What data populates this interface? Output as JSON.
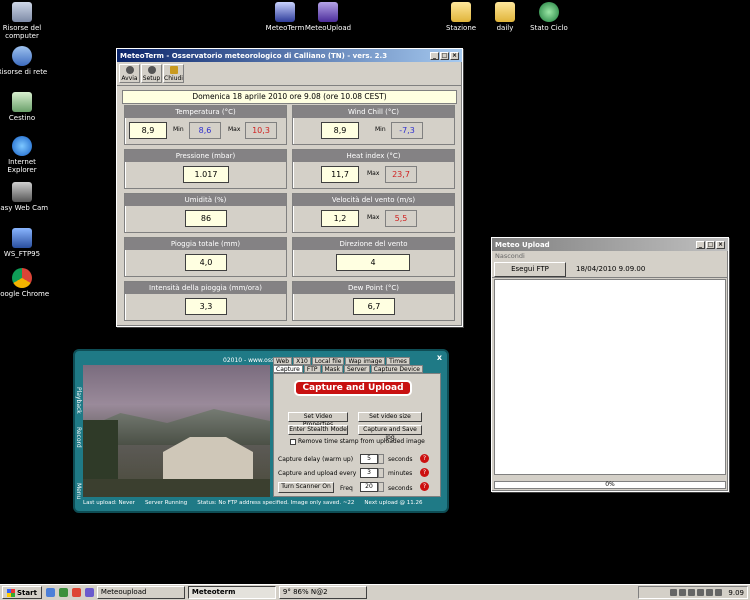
{
  "desktop_icons_left": [
    {
      "label": "Risorse del computer",
      "icon": "my-computer-icon"
    },
    {
      "label": "Risorse di rete",
      "icon": "network-icon"
    },
    {
      "label": "Cestino",
      "icon": "recycle-bin-icon"
    },
    {
      "label": "Internet Explorer",
      "icon": "ie-icon"
    },
    {
      "label": "Easy Web Cam",
      "icon": "webcam-icon"
    },
    {
      "label": "WS_FTP95",
      "icon": "ftp-icon"
    },
    {
      "label": "Google Chrome",
      "icon": "chrome-icon"
    }
  ],
  "desktop_icons_top": [
    {
      "label": "MeteoTerm",
      "icon": "meteoterm-icon"
    },
    {
      "label": "MeteoUpload",
      "icon": "meteoupload-icon"
    },
    {
      "label": "Stazione",
      "icon": "folder-icon"
    },
    {
      "label": "daily",
      "icon": "folder-icon"
    },
    {
      "label": "Stato Ciclo",
      "icon": "globe-icon"
    }
  ],
  "meteoterm": {
    "title": "MeteoTerm - Osservatorio meteorologico di Calliano (TN) - vers. 2.3",
    "toolbar": {
      "avvia": "Avvia",
      "setup": "Setup",
      "chiudi": "Chiudi"
    },
    "date": "Domenica 18 aprile 2010 ore 9.08 (ore 10.08 CEST)",
    "min_label": "Min",
    "max_label": "Max",
    "panels": {
      "temperatura": {
        "title": "Temperatura (°C)",
        "value": "8,9",
        "min": "8,6",
        "max": "10,3"
      },
      "wind_chill": {
        "title": "Wind Chill (°C)",
        "value": "8,9",
        "min": "-7,3"
      },
      "pressione": {
        "title": "Pressione (mbar)",
        "value": "1.017"
      },
      "heat_index": {
        "title": "Heat index (°C)",
        "value": "11,7",
        "max": "23,7"
      },
      "umidita": {
        "title": "Umidità (%)",
        "value": "86"
      },
      "velocita": {
        "title": "Velocità del vento (m/s)",
        "value": "1,2",
        "max": "5,5"
      },
      "pioggia": {
        "title": "Pioggia totale (mm)",
        "value": "4,0"
      },
      "direzione": {
        "title": "Direzione del vento",
        "value": "4"
      },
      "intensita": {
        "title": "Intensità della pioggia (mm/ora)",
        "value": "3,3"
      },
      "dew_point": {
        "title": "Dew Point (°C)",
        "value": "6,7"
      }
    }
  },
  "meteoupload": {
    "title": "Meteo Upload",
    "menu": "Nascondi",
    "button": "Esegui FTP",
    "status": "18/04/2010 9.09.00",
    "progress": "0%"
  },
  "capture": {
    "top_text": "02010 - www.osservat",
    "side_labels": [
      "Playback",
      "Record",
      "Menu"
    ],
    "tabs_row1": [
      "Web",
      "X10",
      "Local file",
      "Wap image",
      "Times"
    ],
    "tabs_row2": [
      "Capture",
      "FTP",
      "Mask",
      "Server",
      "Capture Device"
    ],
    "main_button": "Capture and Upload",
    "btn_video_props": "Set Video Properties",
    "btn_video_size": "Set video size",
    "btn_stealth": "Enter Stealth Mode",
    "btn_capture_save": "Capture and Save jpg",
    "chk_remove": "Remove time stamp from uploaded image",
    "delay_label": "Capture delay (warm up)",
    "delay_value": "5",
    "delay_unit": "seconds",
    "every_label": "Capture and upload every",
    "every_value": "3",
    "every_unit": "minutes",
    "scanner_btn": "Turn Scanner On",
    "freq_label": "Freq",
    "freq_value": "20",
    "freq_unit": "seconds",
    "status": [
      "Last upload: Never",
      "Server Running",
      "Status: No FTP address specified. Image only saved. ~22",
      "Next upload @ 11.26"
    ],
    "close": "x"
  },
  "taskbar": {
    "start": "Start",
    "tasks": [
      "Meteoupload",
      "Meteoterm",
      "9° 86% N@2"
    ],
    "clock": "9.09"
  }
}
